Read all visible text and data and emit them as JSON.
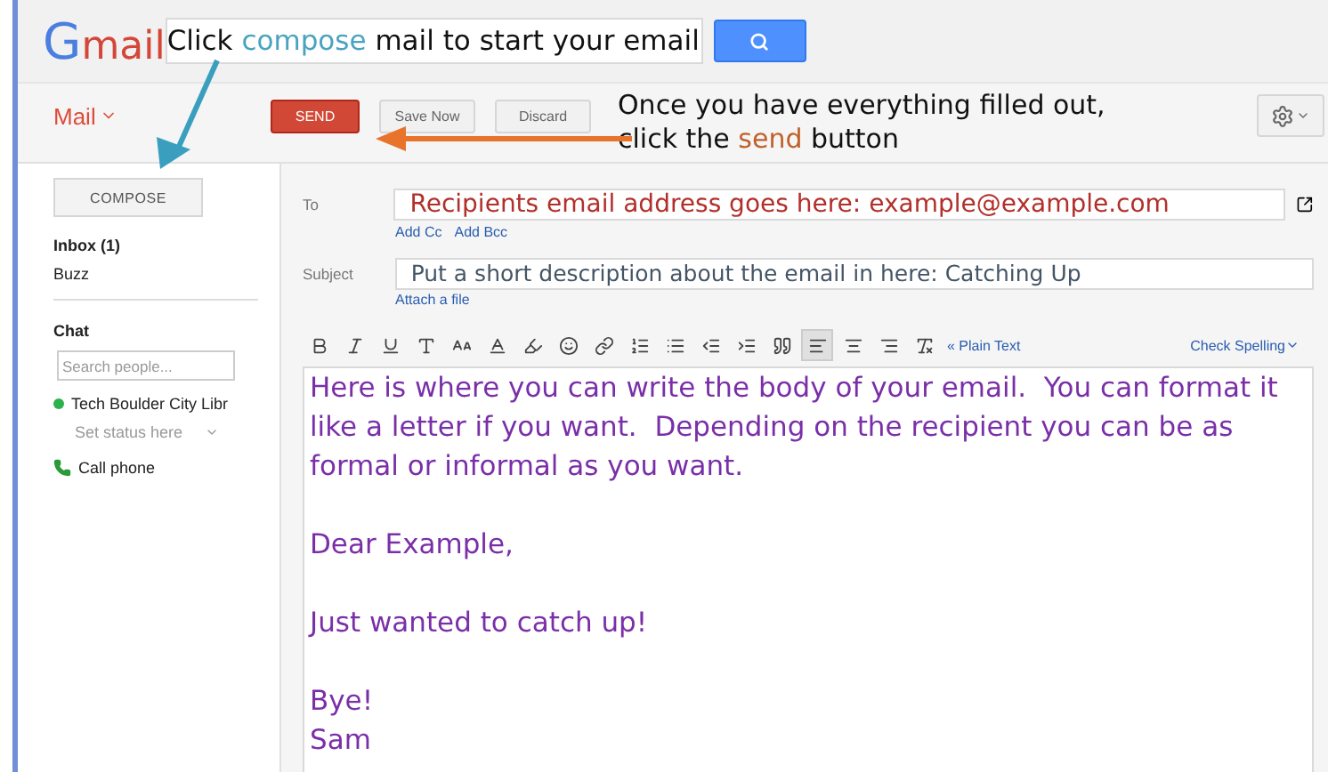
{
  "header": {
    "logo": {
      "g": "G",
      "rest": "mail"
    },
    "search_annotation": "Click *compose* mail to start your email"
  },
  "actions": {
    "mail_menu": "Mail",
    "buttons": [
      {
        "label": "SEND",
        "kind": "primary"
      },
      {
        "label": "Save Now",
        "kind": "secondary"
      },
      {
        "label": "Discard",
        "kind": "secondary"
      }
    ],
    "annotation": [
      "Once you have everything filled out,",
      "click the **send** button"
    ]
  },
  "sidebar": {
    "compose": "COMPOSE",
    "folders": [
      {
        "label": "Inbox (1)",
        "selected": true
      },
      {
        "label": "Buzz",
        "selected": false
      }
    ],
    "chat_title": "Chat",
    "search": {
      "placeholder": "Search people..."
    },
    "contact": {
      "name": "Tech Boulder City Libr",
      "color": "#2bb24c"
    },
    "status": "Set status here",
    "call": "Call phone"
  },
  "compose": {
    "to_label": "To",
    "to_value": "Recipients email address goes here: example@example.com",
    "cc_links": [
      "Add Cc",
      "Add Bcc"
    ],
    "subject_label": "Subject",
    "subject_value": "Put a short description about the email in here: Catching Up",
    "attach": "Attach a file",
    "toolbar": [
      {
        "kind": "bold",
        "selected": false
      },
      {
        "kind": "italic",
        "selected": false
      },
      {
        "kind": "underline",
        "selected": false
      },
      {
        "kind": "font",
        "selected": false
      },
      {
        "kind": "size",
        "selected": false
      },
      {
        "kind": "color",
        "selected": false
      },
      {
        "kind": "highlight",
        "selected": false
      },
      {
        "kind": "emoji",
        "selected": false
      },
      {
        "kind": "link",
        "selected": false
      },
      {
        "kind": "numbered",
        "selected": false
      },
      {
        "kind": "bulleted",
        "selected": false
      },
      {
        "kind": "outdent",
        "selected": false
      },
      {
        "kind": "indent",
        "selected": false
      },
      {
        "kind": "quote",
        "selected": false
      },
      {
        "kind": "align-left",
        "selected": true
      },
      {
        "kind": "align-center",
        "selected": false
      },
      {
        "kind": "align-right",
        "selected": false
      },
      {
        "kind": "clear",
        "selected": false
      }
    ],
    "plain_text": "« Plain Text",
    "spelling": "Check Spelling",
    "body": [
      "Here is where you can write the body of your email.  You can format it like a letter if you want.  Depending on the recipient you can be as formal or informal as you want.",
      "Dear Example,",
      "Just wanted to catch up!",
      "Bye!\nSam"
    ]
  }
}
